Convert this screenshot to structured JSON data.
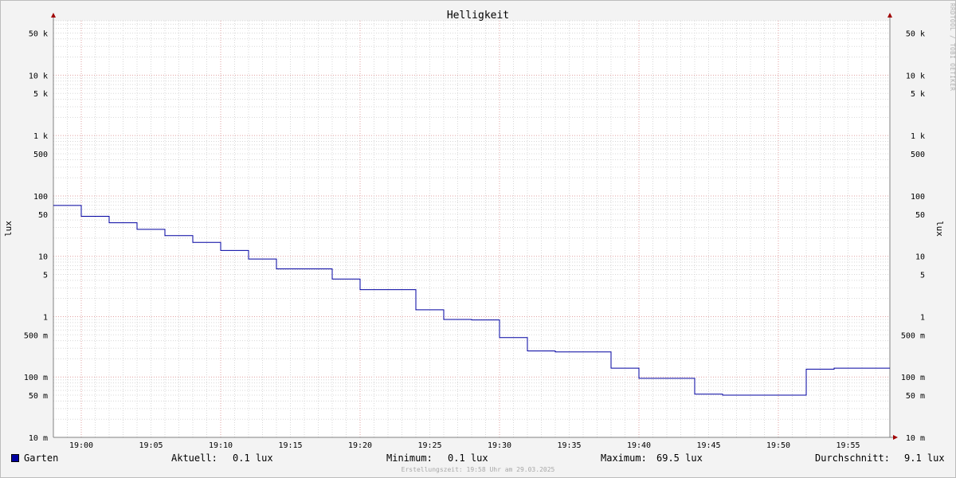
{
  "chart_data": {
    "type": "line",
    "title": "Helligkeit",
    "ylabel": "lux",
    "yscale": "log",
    "ylim": [
      0.01,
      80000
    ],
    "xlim_minutes": [
      "18:58",
      "19:58"
    ],
    "grid": true,
    "y_ticks": [
      {
        "value": 50000,
        "label": "50 k"
      },
      {
        "value": 10000,
        "label": "10 k"
      },
      {
        "value": 5000,
        "label": "5 k"
      },
      {
        "value": 1000,
        "label": "1 k"
      },
      {
        "value": 500,
        "label": "500"
      },
      {
        "value": 100,
        "label": "100"
      },
      {
        "value": 50,
        "label": "50"
      },
      {
        "value": 10,
        "label": "10"
      },
      {
        "value": 5,
        "label": "5"
      },
      {
        "value": 1,
        "label": "1"
      },
      {
        "value": 0.5,
        "label": "500 m"
      },
      {
        "value": 0.1,
        "label": "100 m"
      },
      {
        "value": 0.05,
        "label": "50 m"
      },
      {
        "value": 0.01,
        "label": "10 m"
      }
    ],
    "x_ticks": [
      "19:00",
      "19:05",
      "19:10",
      "19:15",
      "19:20",
      "19:25",
      "19:30",
      "19:35",
      "19:40",
      "19:45",
      "19:50",
      "19:55"
    ],
    "series": [
      {
        "name": "Garten",
        "color": "#0000a0",
        "points": [
          {
            "t": "18:58",
            "y": 69.5
          },
          {
            "t": "19:00",
            "y": 46
          },
          {
            "t": "19:02",
            "y": 36
          },
          {
            "t": "19:04",
            "y": 28
          },
          {
            "t": "19:06",
            "y": 22
          },
          {
            "t": "19:08",
            "y": 17
          },
          {
            "t": "19:10",
            "y": 12.5
          },
          {
            "t": "19:12",
            "y": 9
          },
          {
            "t": "19:14",
            "y": 6.2
          },
          {
            "t": "19:18",
            "y": 4.2
          },
          {
            "t": "19:20",
            "y": 2.8
          },
          {
            "t": "19:24",
            "y": 1.3
          },
          {
            "t": "19:26",
            "y": 0.9
          },
          {
            "t": "19:28",
            "y": 0.88
          },
          {
            "t": "19:30",
            "y": 0.45
          },
          {
            "t": "19:32",
            "y": 0.27
          },
          {
            "t": "19:34",
            "y": 0.26
          },
          {
            "t": "19:38",
            "y": 0.14
          },
          {
            "t": "19:40",
            "y": 0.095
          },
          {
            "t": "19:44",
            "y": 0.052
          },
          {
            "t": "19:46",
            "y": 0.05
          },
          {
            "t": "19:52",
            "y": 0.135
          },
          {
            "t": "19:54",
            "y": 0.14
          },
          {
            "t": "19:58",
            "y": 0.14
          }
        ]
      }
    ]
  },
  "legend": {
    "series_name": "Garten",
    "current_label": "Aktuell:",
    "current_value": "0.1 lux",
    "min_label": "Minimum:",
    "min_value": "0.1 lux",
    "max_label": "Maximum:",
    "max_value": "69.5 lux",
    "avg_label": "Durchschnitt:",
    "avg_value": "9.1 lux"
  },
  "footer": "Erstellungszeit: 19:58 Uhr am 29.03.2025",
  "watermark": "RRDTOOL / TOBI OETIKER",
  "colors": {
    "background": "#f3f3f3",
    "plot_background": "#ffffff",
    "line": "#0000a0",
    "major_grid": "#e0a0a0",
    "minor_grid": "#d8d8d8",
    "axis_arrow": "#a00000"
  }
}
